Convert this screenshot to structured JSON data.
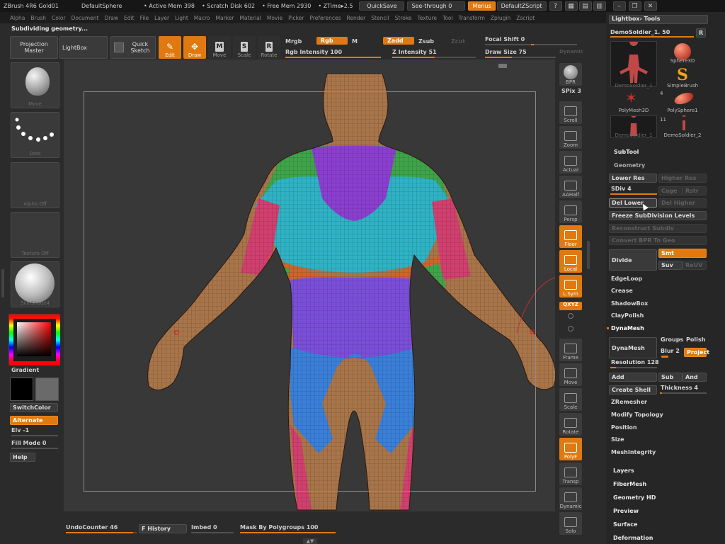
{
  "titlebar": {
    "app": "ZBrush 4R6 Gold01",
    "project": "DefaultSphere",
    "active_mem": "• Active Mem 398",
    "scratch_disk": "• Scratch Disk 602",
    "free_mem": "• Free Mem 2930",
    "ztime": "• ZTime▸2.5",
    "quicksave": "QuickSave",
    "seethrough": "See-through  0",
    "menus": "Menus",
    "zscript": "DefaultZScript"
  },
  "menubar": [
    "Alpha",
    "Brush",
    "Color",
    "Document",
    "Draw",
    "Edit",
    "File",
    "Layer",
    "Light",
    "Macro",
    "Marker",
    "Material",
    "Movie",
    "Picker",
    "Preferences",
    "Render",
    "Stencil",
    "Stroke",
    "Texture",
    "Tool",
    "Transform",
    "Zplugin",
    "Zscript"
  ],
  "status_text": "Subdividing geometry...",
  "top_shelf": {
    "projection_master": "Projection Master",
    "lightbox": "LightBox",
    "quick_sketch": "Quick Sketch",
    "tools": [
      {
        "label": "Edit",
        "on": true
      },
      {
        "label": "Draw",
        "on": true
      },
      {
        "label": "Move",
        "on": false
      },
      {
        "label": "Scale",
        "on": false
      },
      {
        "label": "Rotate",
        "on": false
      }
    ],
    "mrgb": "Mrgb",
    "rgb": "Rgb",
    "m": "M",
    "zadd": "Zadd",
    "zsub": "Zsub",
    "zcut": "Zcut",
    "rgb_intensity": "Rgb Intensity 100",
    "z_intensity": "Z Intensity 51",
    "focal_shift": "Focal Shift 0",
    "draw_size": "Draw Size 75",
    "dynamic": "Dynamic",
    "rgb_intensity_value": 100,
    "z_intensity_value": 51,
    "focal_shift_value": 0,
    "draw_size_value": 75
  },
  "left_shelf": {
    "brush": "Move",
    "stroke": "Dots",
    "alpha": "Alpha Off",
    "texture": "Texture Off",
    "material": "SkinShade4",
    "gradient": "Gradient",
    "switchcolor": "SwitchColor",
    "alternate": "Alternate",
    "elv": "Elv -1",
    "fill_mode": "Fill Mode 0",
    "help": "Help"
  },
  "right_shelf": {
    "bpr": "BPR",
    "spix": "SPix 3",
    "buttons": [
      {
        "label": "Scroll",
        "on": false
      },
      {
        "label": "Zoom",
        "on": false
      },
      {
        "label": "Actual",
        "on": false
      },
      {
        "label": "AAHalf",
        "on": false
      },
      {
        "label": "Persp",
        "on": false
      },
      {
        "label": "Floor",
        "on": true
      },
      {
        "label": "Local",
        "on": true
      },
      {
        "label": "L.Sym",
        "on": true
      }
    ],
    "xyz": "QXYZ",
    "lower_buttons": [
      {
        "label": "Frame",
        "on": false
      },
      {
        "label": "Move",
        "on": false
      },
      {
        "label": "Scale",
        "on": false
      },
      {
        "label": "Rotate",
        "on": false
      },
      {
        "label": "PolyF",
        "on": true
      },
      {
        "label": "Transp",
        "on": false
      },
      {
        "label": "Dynamic",
        "on": false
      },
      {
        "label": "Solo",
        "on": false
      }
    ]
  },
  "tool_panel": {
    "header": "Lightbox› Tools",
    "current_tool": "DemoSoldier_1. 50",
    "r_button": "R",
    "thumbs": [
      {
        "caption": "DemoSoldier_1"
      },
      {
        "caption": "Sphere3D"
      },
      {
        "caption": "SimpleBrush"
      },
      {
        "caption": "PolyMesh3D"
      },
      {
        "caption": "PolySphere1"
      },
      {
        "caption": "DemoSoldier_1"
      },
      {
        "caption": "DemoSoldier_2"
      }
    ],
    "badge_4": "4",
    "badge_11": "11",
    "subtool": "SubTool",
    "geometry": "Geometry",
    "lower_res": "Lower Res",
    "higher_res": "Higher Res",
    "sdiv": "SDiv 4",
    "cage": "Cage",
    "rstr": "Rstr",
    "del_lower": "Del Lower",
    "del_higher": "Del Higher",
    "freeze": "Freeze SubDivision Levels",
    "reconstruct": "Reconstruct Subdiv",
    "convert_bpr": "Convert BPR To Geo",
    "divide": "Divide",
    "smt": "Smt",
    "suv": "Suv",
    "reuv": "ReUV",
    "edgeloop": "EdgeLoop",
    "crease": "Crease",
    "shadowbox": "ShadowBox",
    "claypolish": "ClayPolish",
    "dynamesh_section": "DynaMesh",
    "dynamesh_btn": "DynaMesh",
    "groups": "Groups",
    "polish": "Polish",
    "blur": "Blur 2",
    "project": "Project",
    "resolution": "Resolution 128",
    "add": "Add",
    "sub": "Sub",
    "and": "And",
    "create_shell": "Create Shell",
    "thickness": "Thickness 4",
    "zremesher": "ZRemesher",
    "modify_topology": "Modify Topology",
    "position": "Position",
    "size": "Size",
    "meshintegrity": "MeshIntegrity",
    "layers": "Layers",
    "fibermesh": "FiberMesh",
    "geometry_hd": "Geometry HD",
    "preview": "Preview",
    "surface": "Surface",
    "deformation": "Deformation",
    "sdiv_value": 4,
    "resolution_value": 128,
    "thickness_value": 4
  },
  "bottom_bar": {
    "undo_counter": "UndoCounter 46",
    "history": "F History",
    "imbed": "Imbed 0",
    "mask_by_polygroups": "Mask By Polygroups 100",
    "undo_value": 46,
    "mask_value": 100
  },
  "colors": {
    "accent": "#e07a10",
    "skin": "#a8754a",
    "group_green": "#3fa34a",
    "group_cyan": "#2fb2c4",
    "group_purple": "#8a3fcf",
    "group_pink": "#d0406f",
    "group_blue": "#3a7fd8",
    "group_orange": "#d0642a"
  }
}
